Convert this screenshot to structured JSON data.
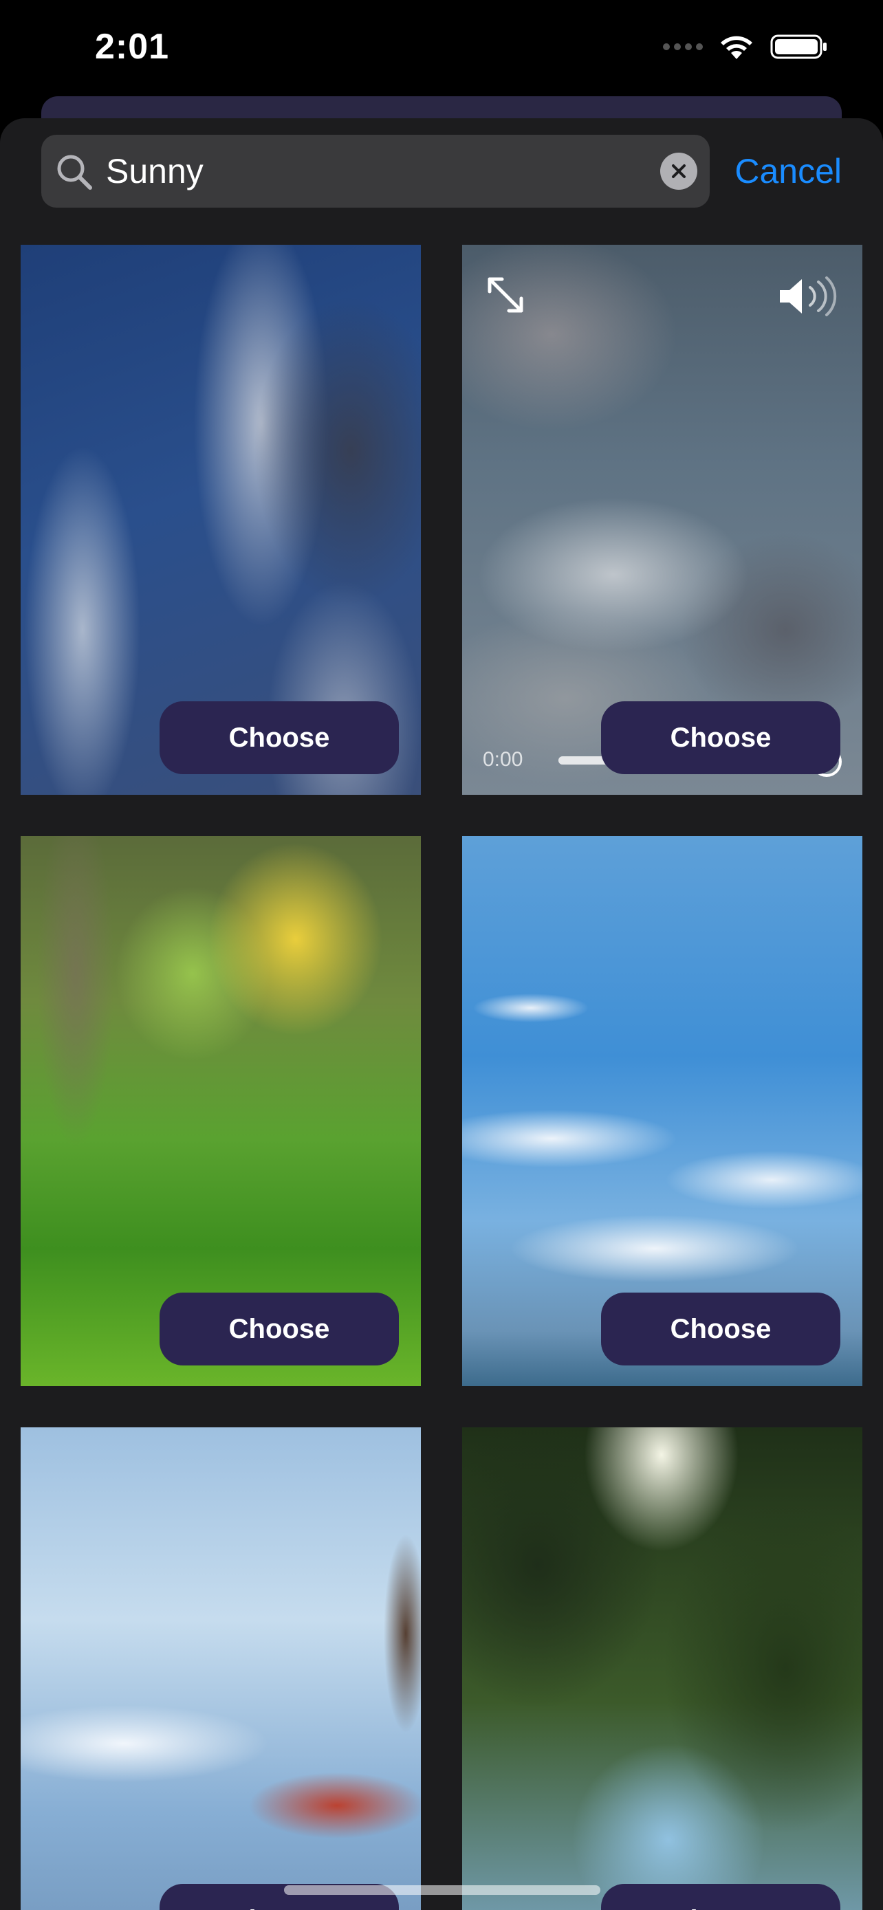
{
  "status_bar": {
    "time": "2:01",
    "icons": [
      "cellular-signal-icon",
      "wifi-icon",
      "battery-icon"
    ]
  },
  "search": {
    "value": "Sunny",
    "cancel_label": "Cancel"
  },
  "tiles": [
    {
      "image": "dark-clouds-blue-sky",
      "choose_label": "Choose"
    },
    {
      "image": "cloudy-sky-video",
      "choose_label": "Choose",
      "video": {
        "time": "0:00",
        "progress": 0.3
      }
    },
    {
      "image": "grass-close-up",
      "choose_label": "Choose"
    },
    {
      "image": "blue-sky-white-clouds",
      "choose_label": "Choose"
    },
    {
      "image": "woman-holding-cup-under-sky",
      "choose_label": "Choose"
    },
    {
      "image": "sunlight-through-trees",
      "choose_label": "Choose"
    }
  ],
  "colors": {
    "accent": "#1a8cff",
    "choose_button": "#2b2551",
    "sheet_background": "#1c1c1e",
    "search_field": "#3a3a3c"
  }
}
